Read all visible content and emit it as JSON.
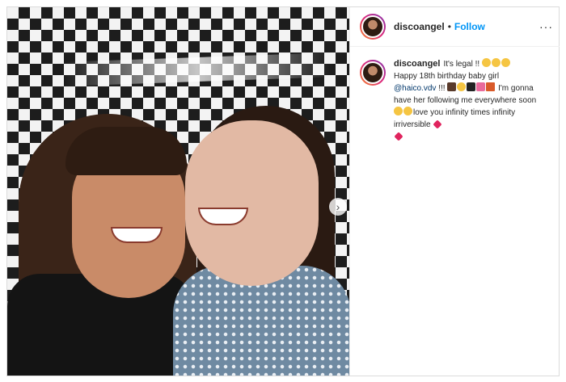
{
  "post": {
    "username": "discoangel",
    "dot": "•",
    "follow_label": "Follow",
    "more_label": "···",
    "carousel_next": "›"
  },
  "caption": {
    "username": "discoangel",
    "line1": "It's legal !!",
    "line2": "Happy 18th birthday baby girl",
    "mention": "@haico.vdv",
    "after_mention": "!!!",
    "line3": "I'm gonna have her following me everywhere soon",
    "line4": "love you infinity times infinity irriversible"
  },
  "icons": {
    "laugh": "grinning-squinting-face",
    "cake": "birthday-cake",
    "party": "party-popper",
    "gift": "wrapped-gift",
    "heart": "red-heart"
  }
}
